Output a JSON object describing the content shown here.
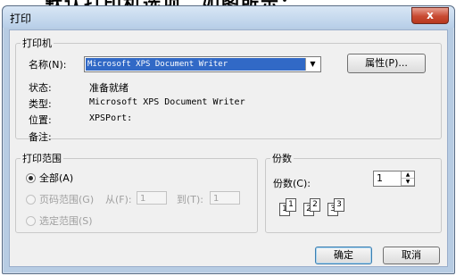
{
  "cropped_top_text": "默认打印机选项。如图所示：",
  "window": {
    "title": "打印",
    "close_symbol": "x"
  },
  "printer_group": {
    "legend": "打印机",
    "name_label": "名称(N):",
    "name_value": "Microsoft XPS Document Writer",
    "properties_button": "属性(P)...",
    "status_label": "状态:",
    "status_value": "准备就绪",
    "type_label": "类型:",
    "type_value": "Microsoft XPS Document Writer",
    "where_label": "位置:",
    "where_value": "XPSPort:",
    "comment_label": "备注:",
    "comment_value": ""
  },
  "range_group": {
    "legend": "打印范围",
    "all_label": "全部(A)",
    "pages_label": "页码范围(G)",
    "from_label": "从(F):",
    "from_value": "1",
    "to_label": "到(T):",
    "to_value": "1",
    "selection_label": "选定范围(S)"
  },
  "copies_group": {
    "legend": "份数",
    "count_label": "份数(C):",
    "count_value": "1",
    "collate_pages": [
      "1",
      "1",
      "2",
      "2",
      "3",
      "3"
    ]
  },
  "buttons": {
    "ok": "确定",
    "cancel": "取消"
  },
  "colors": {
    "selection": "#3169c6",
    "close_button": "#c84a32",
    "title_bar": "#c5d8ee"
  },
  "icons": {
    "spin_up": "▲",
    "spin_down": "▼",
    "dropdown": "▼"
  }
}
